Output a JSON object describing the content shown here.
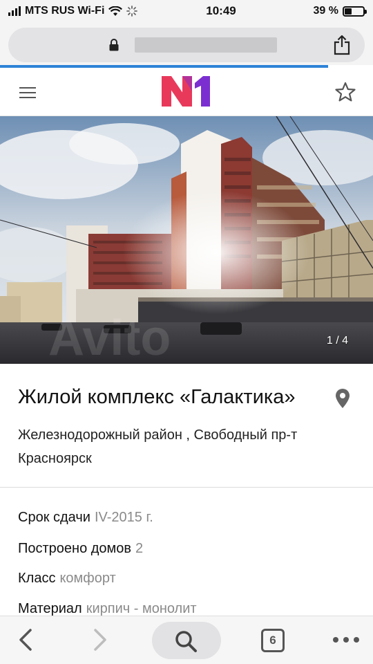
{
  "status_bar": {
    "carrier": "MTS RUS Wi-Fi",
    "time": "10:49",
    "battery": "39 %",
    "battery_level": 0.39
  },
  "browser": {
    "url_redacted": true
  },
  "site": {
    "logo_text": "N1",
    "logo_colors": [
      "#e8395b",
      "#7b2fd0"
    ]
  },
  "gallery": {
    "counter": "1 / 4"
  },
  "listing": {
    "title": "Жилой комплекс «Галактика»",
    "address_line1": "Железнодорожный район , Свободный пр-т",
    "address_line2": "Красноярск",
    "properties": [
      {
        "label": "Срок сдачи",
        "value": "IV-2015 г."
      },
      {
        "label": "Построено домов",
        "value": "2"
      },
      {
        "label": "Класс",
        "value": "комфорт"
      },
      {
        "label": "Материал",
        "value": "кирпич - монолит"
      }
    ]
  },
  "toolbar": {
    "tabs_count": "6"
  },
  "colors": {
    "accent": "#2f84d6",
    "value_text": "#8a8a8a"
  }
}
